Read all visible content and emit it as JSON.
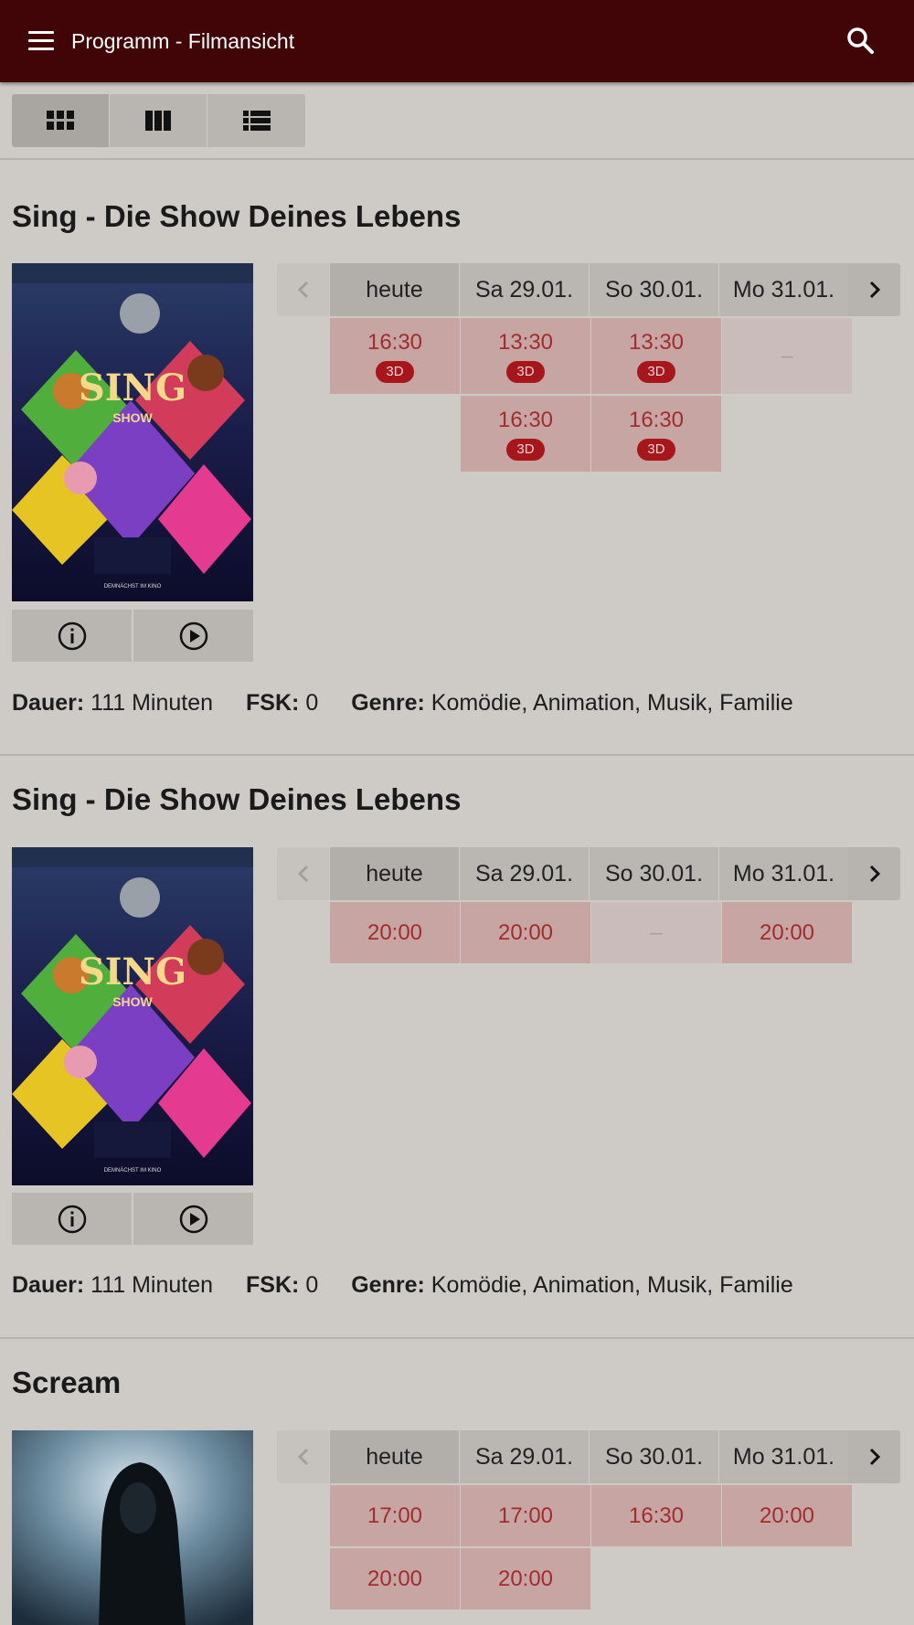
{
  "appbar": {
    "title": "Programm - Filmansicht",
    "menu_icon": "hamburger-menu-icon",
    "search_icon": "search-icon"
  },
  "view_switch": {
    "options": [
      "grid-view-icon",
      "column-view-icon",
      "list-view-icon"
    ],
    "selected": "grid-view-icon"
  },
  "colors": {
    "appbar": "#410507",
    "background": "#cecbc7",
    "slot": "#c6a5a2",
    "slot_text": "#a32c2f",
    "badge": "#a7161b"
  },
  "labels": {
    "duration": "Dauer:",
    "fsk": "FSK:",
    "genre": "Genre:"
  },
  "days": [
    "heute",
    "Sa 29.01.",
    "So 30.01.",
    "Mo 31.01."
  ],
  "movies": [
    {
      "title": "Sing - Die Show Deines Lebens",
      "duration": "111 Minuten",
      "fsk": "0",
      "genre": "Komödie, Animation, Musik, Familie",
      "rows": [
        [
          {
            "time": "16:30",
            "badge": "3D"
          },
          {
            "time": "13:30",
            "badge": "3D"
          },
          {
            "time": "13:30",
            "badge": "3D"
          },
          {
            "time": "–",
            "empty": true
          }
        ],
        [
          {
            "blank": true
          },
          {
            "time": "16:30",
            "badge": "3D"
          },
          {
            "time": "16:30",
            "badge": "3D"
          },
          {
            "blank": true
          }
        ]
      ]
    },
    {
      "title": "Sing - Die Show Deines Lebens",
      "duration": "111 Minuten",
      "fsk": "0",
      "genre": "Komödie, Animation, Musik, Familie",
      "rows": [
        [
          {
            "time": "20:00"
          },
          {
            "time": "20:00"
          },
          {
            "time": "–",
            "empty": true
          },
          {
            "time": "20:00"
          }
        ]
      ]
    },
    {
      "title": "Scream",
      "rows": [
        [
          {
            "time": "17:00"
          },
          {
            "time": "17:00"
          },
          {
            "time": "16:30"
          },
          {
            "time": "20:00"
          }
        ],
        [
          {
            "time": "20:00"
          },
          {
            "time": "20:00"
          },
          {
            "blank": true
          },
          {
            "blank": true
          }
        ]
      ]
    }
  ]
}
